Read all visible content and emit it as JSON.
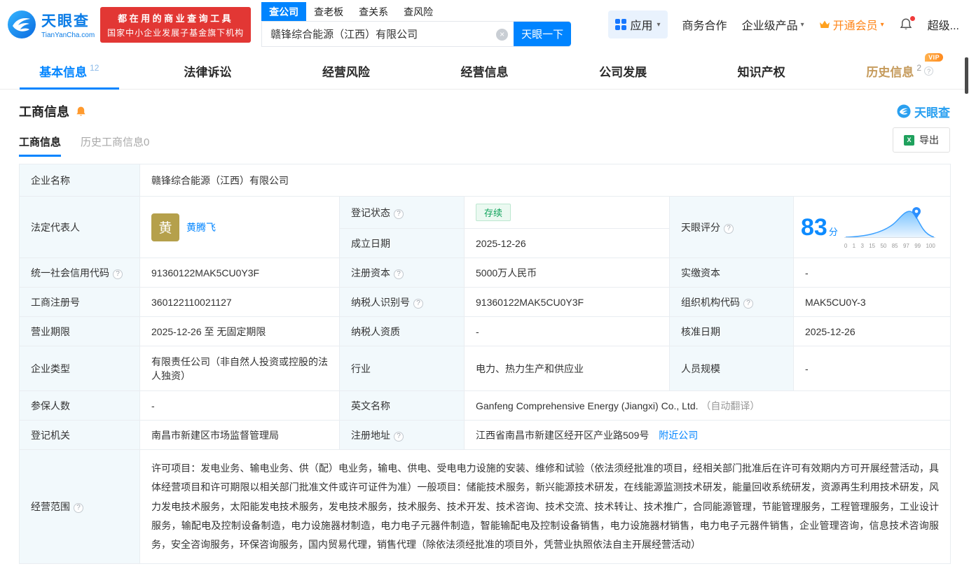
{
  "colors": {
    "accent": "#0084ff",
    "brand-red": "#e23734",
    "vip-orange": "#ff8519",
    "status-green": "#10a35c",
    "history-tan": "#c59a5b",
    "score-blue": "#0d8bff"
  },
  "icons": {
    "help": "?",
    "clear": "×",
    "caret": "▾",
    "excel": "X"
  },
  "brand": {
    "name": "天眼查",
    "domain": "TianYanCha.com",
    "slogan1": "都在用的商业查询工具",
    "slogan2": "国家中小企业发展子基金旗下机构",
    "watermark": "天眼查"
  },
  "search": {
    "tabs": [
      {
        "label": "查公司",
        "active": true
      },
      {
        "label": "查老板",
        "active": false
      },
      {
        "label": "查关系",
        "active": false
      },
      {
        "label": "查风险",
        "active": false
      }
    ],
    "value": "赣锋综合能源（江西）有限公司",
    "button": "天眼一下"
  },
  "top_nav": {
    "app": "应用",
    "items": [
      "商务合作",
      "企业级产品",
      "开通会员",
      "超级..."
    ]
  },
  "tabs": [
    {
      "label": "基本信息",
      "count": "12"
    },
    {
      "label": "法律诉讼",
      "count": ""
    },
    {
      "label": "经营风险",
      "count": ""
    },
    {
      "label": "经营信息",
      "count": ""
    },
    {
      "label": "公司发展",
      "count": ""
    },
    {
      "label": "知识产权",
      "count": ""
    },
    {
      "label": "历史信息",
      "count": "2",
      "vip": "VIP"
    }
  ],
  "section": {
    "title": "工商信息",
    "subtab_active": "工商信息",
    "subtab_history": "历史工商信息0",
    "export": "导出"
  },
  "score": {
    "value": "83",
    "unit": "分",
    "axis": [
      "0",
      "1",
      "3",
      "15",
      "50",
      "85",
      "97",
      "99",
      "100"
    ]
  },
  "fields": {
    "company_name_label": "企业名称",
    "company_name": "赣锋综合能源（江西）有限公司",
    "legal_rep_label": "法定代表人",
    "legal_rep_initial": "黄",
    "legal_rep_name": "黄腾飞",
    "reg_status_label": "登记状态",
    "reg_status": "存续",
    "score_label": "天眼评分",
    "est_date_label": "成立日期",
    "est_date": "2025-12-26",
    "credit_code_label": "统一社会信用代码",
    "credit_code": "91360122MAK5CU0Y3F",
    "reg_capital_label": "注册资本",
    "reg_capital": "5000万人民币",
    "paid_capital_label": "实缴资本",
    "paid_capital": "-",
    "reg_number_label": "工商注册号",
    "reg_number": "360122110021127",
    "taxpayer_id_label": "纳税人识别号",
    "taxpayer_id": "91360122MAK5CU0Y3F",
    "org_code_label": "组织机构代码",
    "org_code": "MAK5CU0Y-3",
    "business_term_label": "营业期限",
    "business_term": "2025-12-26 至 无固定期限",
    "taxpayer_quality_label": "纳税人资质",
    "taxpayer_quality": "-",
    "approval_date_label": "核准日期",
    "approval_date": "2025-12-26",
    "company_type_label": "企业类型",
    "company_type": "有限责任公司（非自然人投资或控股的法人独资）",
    "industry_label": "行业",
    "industry": "电力、热力生产和供应业",
    "staff_size_label": "人员规模",
    "staff_size": "-",
    "insured_label": "参保人数",
    "insured": "-",
    "english_name_label": "英文名称",
    "english_name": "Ganfeng Comprehensive Energy (Jiangxi) Co., Ltd.",
    "english_name_note": "（自动翻译）",
    "reg_authority_label": "登记机关",
    "reg_authority": "南昌市新建区市场监督管理局",
    "reg_address_label": "注册地址",
    "reg_address": "江西省南昌市新建区经开区产业路509号",
    "nearby_link": "附近公司",
    "business_scope_label": "经营范围",
    "business_scope": "许可项目：发电业务、输电业务、供（配）电业务，输电、供电、受电电力设施的安装、维修和试验（依法须经批准的项目，经相关部门批准后在许可有效期内方可开展经营活动，具体经营项目和许可期限以相关部门批准文件或许可证件为准）一般项目：储能技术服务，新兴能源技术研发，在线能源监测技术研发，能量回收系统研发，资源再生利用技术研发，风力发电技术服务，太阳能发电技术服务，发电技术服务，技术服务、技术开发、技术咨询、技术交流、技术转让、技术推广，合同能源管理，节能管理服务，工程管理服务，工业设计服务，输配电及控制设备制造，电力设施器材制造，电力电子元器件制造，智能输配电及控制设备销售，电力设施器材销售，电力电子元器件销售，企业管理咨询，信息技术咨询服务，安全咨询服务，环保咨询服务，国内贸易代理，销售代理（除依法须经批准的项目外，凭营业执照依法自主开展经营活动）"
  }
}
